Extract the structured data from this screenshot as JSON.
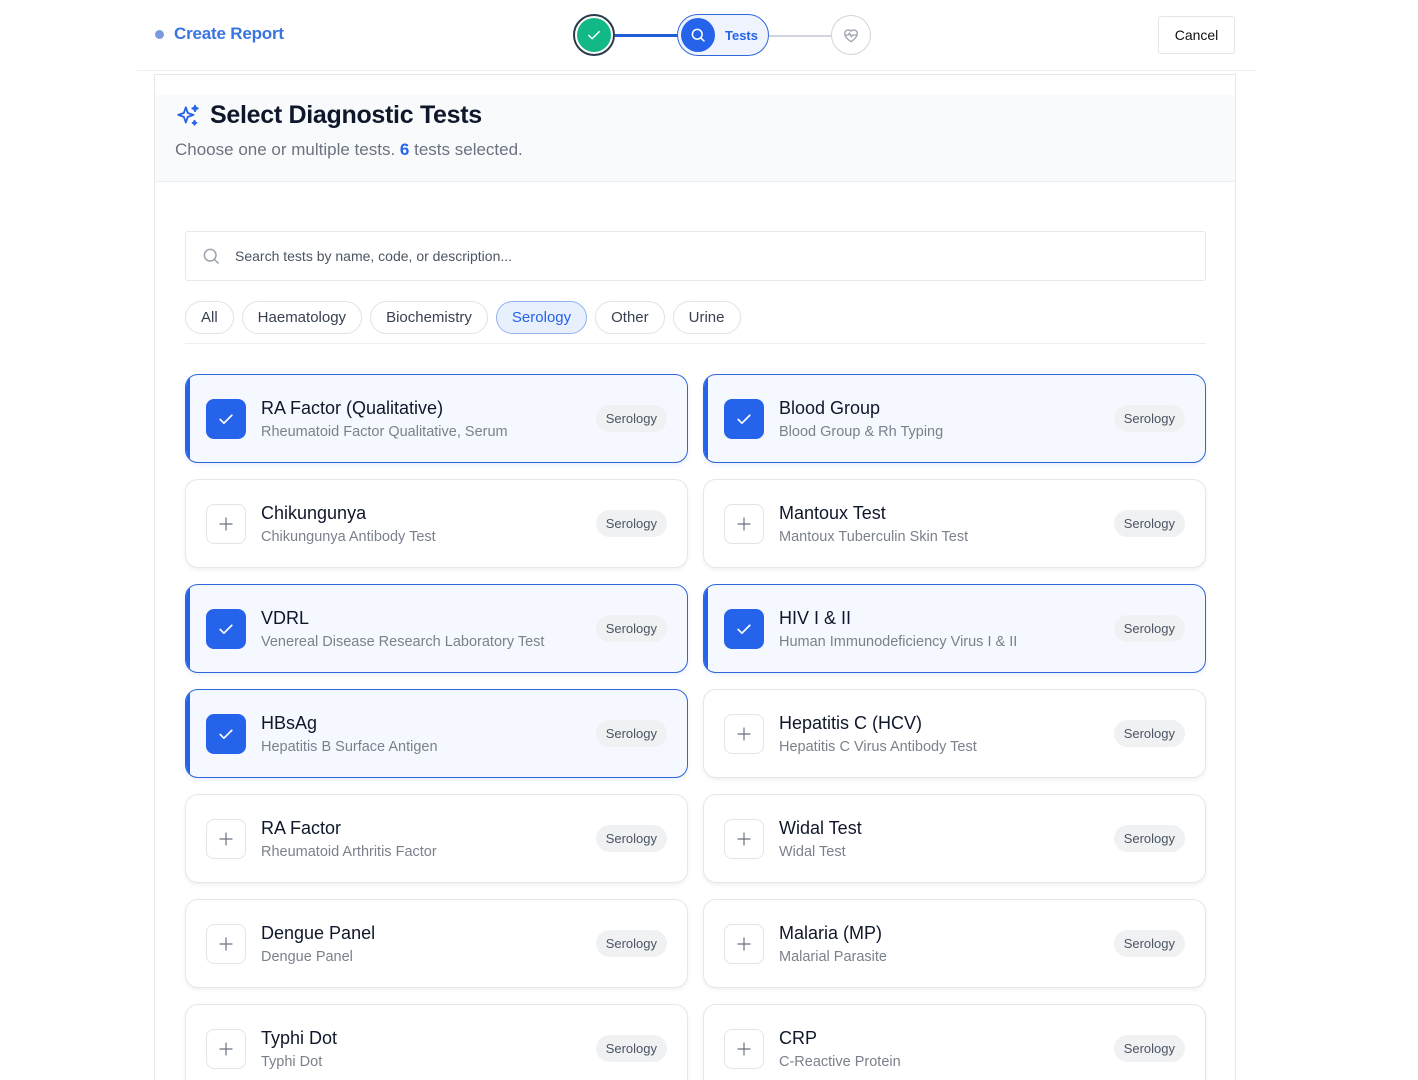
{
  "header": {
    "title": "Create Report",
    "cancel_label": "Cancel",
    "steps": [
      {
        "state": "completed",
        "icon": "check-icon"
      },
      {
        "state": "active",
        "label": "Tests",
        "icon": "search-icon"
      },
      {
        "state": "upcoming",
        "icon": "heart-pulse-icon"
      }
    ]
  },
  "panel": {
    "title": "Select Diagnostic Tests",
    "subtitle_before": "Choose one or multiple tests.",
    "selected_count": "6",
    "subtitle_after": "tests selected.",
    "search_placeholder": "Search tests by name, code, or description...",
    "filters": [
      "All",
      "Haematology",
      "Biochemistry",
      "Serology",
      "Other",
      "Urine"
    ],
    "active_filter": "Serology",
    "tests": [
      {
        "name": "RA Factor (Qualitative)",
        "description": "Rheumatoid Factor Qualitative, Serum",
        "category": "Serology",
        "selected": true
      },
      {
        "name": "Blood Group",
        "description": "Blood Group & Rh Typing",
        "category": "Serology",
        "selected": true
      },
      {
        "name": "Chikungunya",
        "description": "Chikungunya Antibody Test",
        "category": "Serology",
        "selected": false
      },
      {
        "name": "Mantoux Test",
        "description": "Mantoux Tuberculin Skin Test",
        "category": "Serology",
        "selected": false
      },
      {
        "name": "VDRL",
        "description": "Venereal Disease Research Laboratory Test",
        "category": "Serology",
        "selected": true
      },
      {
        "name": "HIV I & II",
        "description": "Human Immunodeficiency Virus I & II",
        "category": "Serology",
        "selected": true
      },
      {
        "name": "HBsAg",
        "description": "Hepatitis B Surface Antigen",
        "category": "Serology",
        "selected": true
      },
      {
        "name": "Hepatitis C (HCV)",
        "description": "Hepatitis C Virus Antibody Test",
        "category": "Serology",
        "selected": false
      },
      {
        "name": "RA Factor",
        "description": "Rheumatoid Arthritis Factor",
        "category": "Serology",
        "selected": false
      },
      {
        "name": "Widal Test",
        "description": "Widal Test",
        "category": "Serology",
        "selected": false
      },
      {
        "name": "Dengue Panel",
        "description": "Dengue Panel",
        "category": "Serology",
        "selected": false
      },
      {
        "name": "Malaria (MP)",
        "description": "Malarial Parasite",
        "category": "Serology",
        "selected": false
      },
      {
        "name": "Typhi Dot",
        "description": "Typhi Dot",
        "category": "Serology",
        "selected": false
      },
      {
        "name": "CRP",
        "description": "C-Reactive Protein",
        "category": "Serology",
        "selected": false
      }
    ]
  },
  "colors": {
    "accent": "#2563eb",
    "success": "#12b886",
    "brand_text": "#3a74e0"
  }
}
